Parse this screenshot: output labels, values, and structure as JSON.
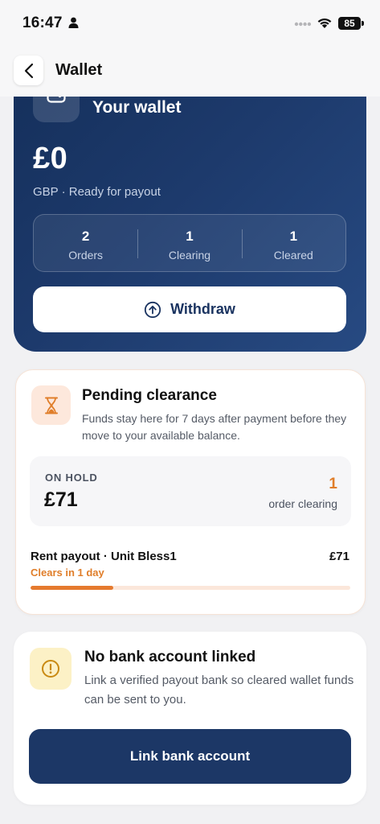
{
  "status_bar": {
    "time": "16:47",
    "battery": "85",
    "icons": [
      "person-icon",
      "signal-dots-icon",
      "wifi-icon",
      "battery-icon"
    ]
  },
  "header": {
    "title": "Wallet",
    "back_icon": "chevron-left-icon"
  },
  "wallet": {
    "title": "Your wallet",
    "icon": "wallet-icon",
    "balance": "£0",
    "subtitle": "GBP · Ready for payout",
    "stats": [
      {
        "value": "2",
        "label": "Orders"
      },
      {
        "value": "1",
        "label": "Clearing"
      },
      {
        "value": "1",
        "label": "Cleared"
      }
    ],
    "withdraw_label": "Withdraw",
    "withdraw_icon": "arrow-up-circle-icon"
  },
  "pending": {
    "icon": "hourglass-icon",
    "title": "Pending clearance",
    "description": "Funds stay here for 7 days after payment before they move to your available balance.",
    "hold_label": "ON HOLD",
    "hold_amount": "£71",
    "hold_count": "1",
    "hold_count_label": "order clearing",
    "payouts": [
      {
        "name": "Rent payout · Unit Bless1",
        "amount": "£71",
        "clears": "Clears in 1 day",
        "progress": 0.26
      }
    ]
  },
  "bank": {
    "icon": "warning-circle-icon",
    "title": "No bank account linked",
    "description": "Link a verified payout bank so cleared wallet funds can be sent to you.",
    "button_label": "Link bank account"
  },
  "colors": {
    "navy": "#1c3766",
    "accent_orange": "#e07e2a",
    "warning_yellow": "#fcf1c6"
  }
}
